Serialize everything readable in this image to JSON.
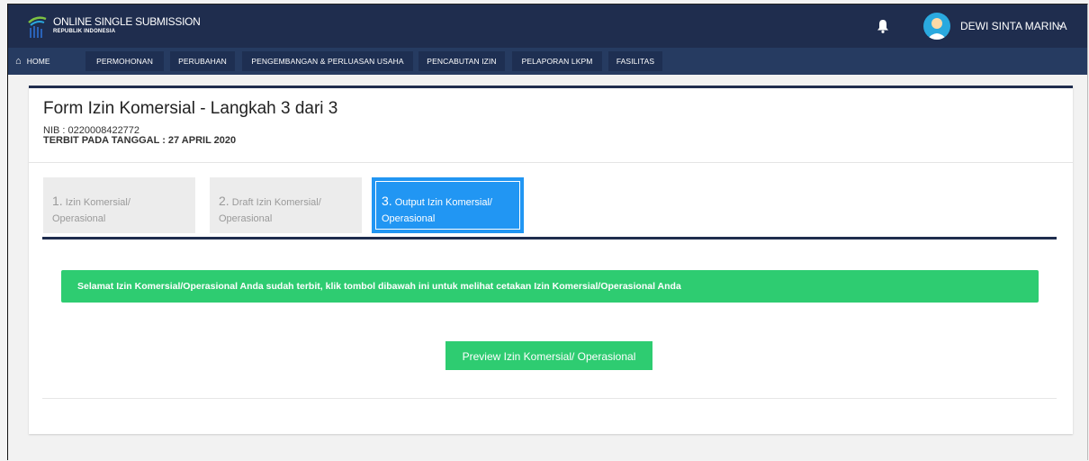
{
  "header": {
    "brand_title": "ONLINE SINGLE SUBMISSION",
    "brand_subtitle": "REPUBLIK INDONESIA",
    "logo_icon": "oss-logo-icon",
    "notification_icon": "bell-icon",
    "user_name": "DEWI SINTA MARINA",
    "user_menu_icon": "chevron-down-icon",
    "colors": {
      "topbar": "#1f2d4e",
      "navbar": "#263b61",
      "accent": "#2196f3",
      "success": "#2ecc71"
    }
  },
  "nav": {
    "home_icon": "home-icon",
    "items": [
      {
        "label": "HOME"
      },
      {
        "label": "PERMOHONAN"
      },
      {
        "label": "PERUBAHAN"
      },
      {
        "label": "PENGEMBANGAN & PERLUASAN USAHA"
      },
      {
        "label": "PENCABUTAN IZIN"
      },
      {
        "label": "PELAPORAN LKPM"
      },
      {
        "label": "FASILITAS"
      }
    ]
  },
  "form": {
    "title": "Form Izin Komersial - Langkah 3 dari 3",
    "nib": "NIB : 0220008422772",
    "terbit": "TERBIT PADA TANGGAL : 27 APRIL 2020",
    "steps": [
      {
        "num": "1.",
        "line1": "Izin Komersial/",
        "line2": "Operasional"
      },
      {
        "num": "2.",
        "line1": "Draft Izin Komersial/",
        "line2": "Operasional"
      },
      {
        "num": "3.",
        "line1": "Output Izin Komersial/",
        "line2": "Operasional"
      }
    ],
    "active_step": 3,
    "alert_message": "Selamat Izin Komersial/Operasional Anda sudah terbit, klik tombol dibawah ini untuk melihat cetakan Izin Komersial/Operasional Anda",
    "preview_button": "Preview Izin Komersial/ Operasional"
  }
}
